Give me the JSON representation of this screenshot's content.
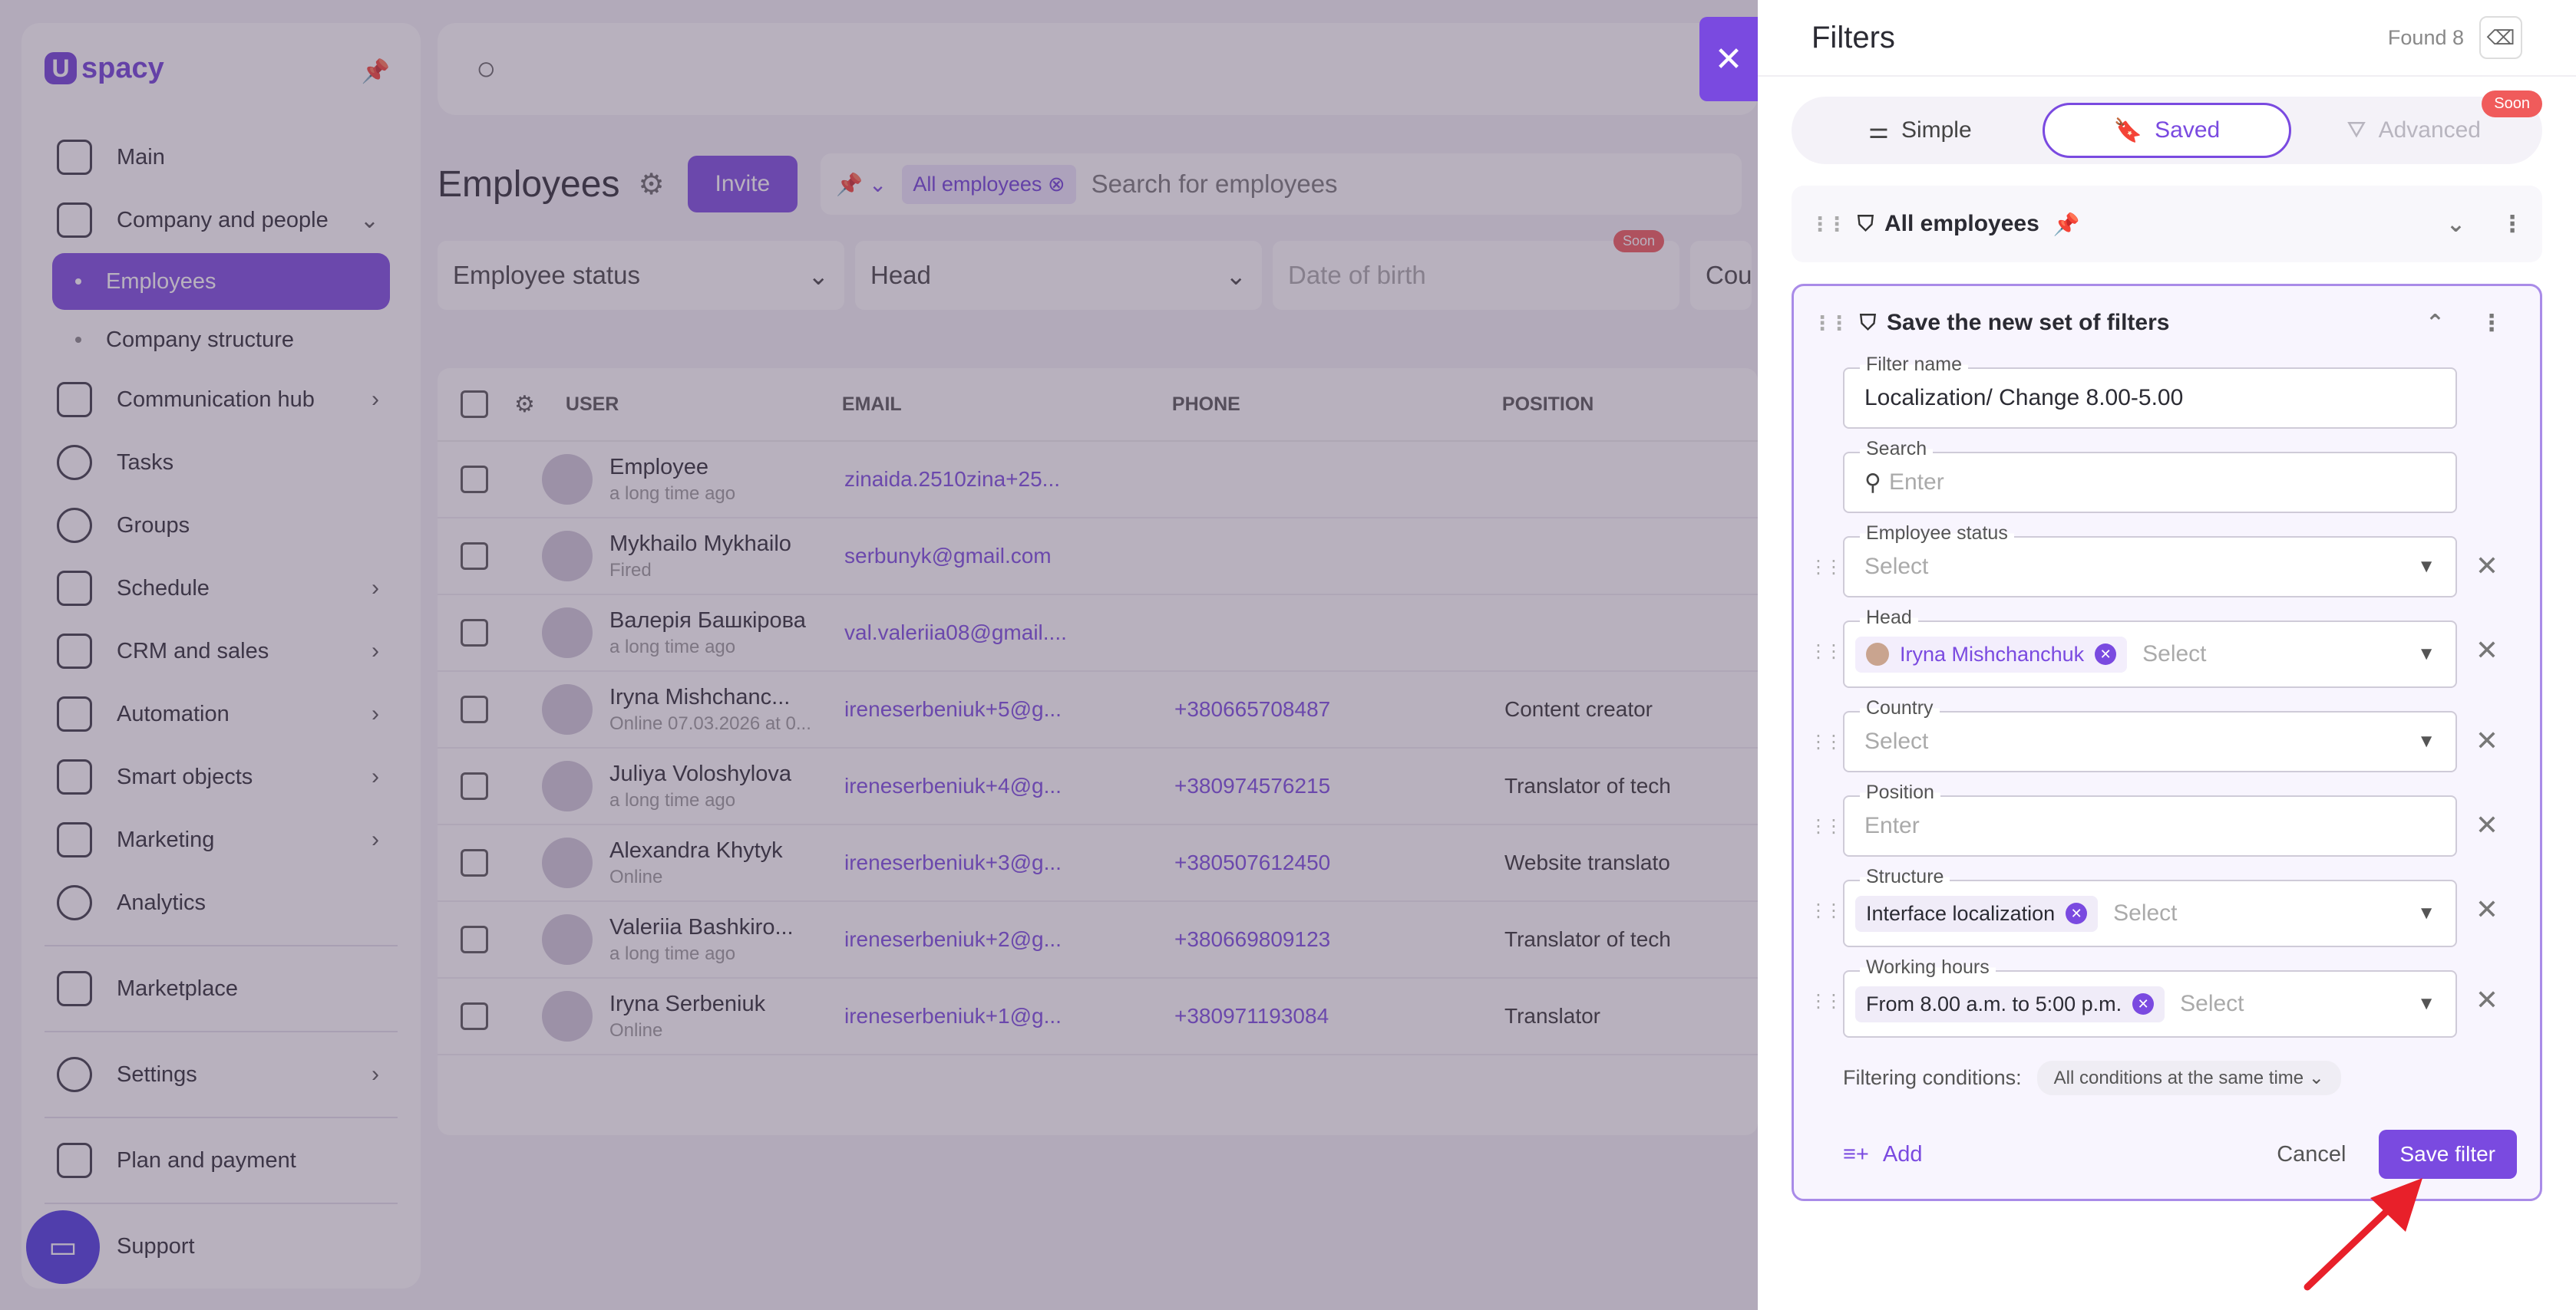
{
  "sidebar": {
    "logo_mark": "U",
    "logo_text": "spacy",
    "items": [
      {
        "label": "Main",
        "chev": ""
      },
      {
        "label": "Company and people",
        "chev": "⌄"
      },
      {
        "label": "Communication hub",
        "chev": "›"
      },
      {
        "label": "Tasks",
        "chev": ""
      },
      {
        "label": "Groups",
        "chev": ""
      },
      {
        "label": "Schedule",
        "chev": "›"
      },
      {
        "label": "CRM and sales",
        "chev": "›"
      },
      {
        "label": "Automation",
        "chev": "›"
      },
      {
        "label": "Smart objects",
        "chev": "›"
      },
      {
        "label": "Marketing",
        "chev": "›"
      },
      {
        "label": "Analytics",
        "chev": ""
      },
      {
        "label": "Marketplace",
        "chev": ""
      },
      {
        "label": "Settings",
        "chev": "›"
      },
      {
        "label": "Plan and payment",
        "chev": ""
      },
      {
        "label": "Support",
        "chev": ""
      }
    ],
    "sub_items": [
      "Employees",
      "Company structure"
    ]
  },
  "employees": {
    "title": "Employees",
    "invite_label": "Invite",
    "chip_all": "All employees",
    "search_placeholder": "Search for employees",
    "filters": [
      "Employee status",
      "Head",
      "Date of birth",
      "Cou"
    ],
    "soon": "Soon",
    "columns": [
      "USER",
      "EMAIL",
      "PHONE",
      "POSITION"
    ],
    "rows": [
      {
        "name": "Employee",
        "sub": "a long time ago",
        "email": "zinaida.2510zina+25...",
        "phone": "",
        "position": ""
      },
      {
        "name": "Mykhailo Mykhailo",
        "sub": "Fired",
        "email": "serbunyk@gmail.com",
        "phone": "",
        "position": ""
      },
      {
        "name": "Валерія Башкірова",
        "sub": "a long time ago",
        "email": "val.valeriia08@gmail....",
        "phone": "",
        "position": ""
      },
      {
        "name": "Iryna Mishchanc...",
        "sub": "Online 07.03.2026 at 0...",
        "email": "ireneserbeniuk+5@g...",
        "phone": "+380665708487",
        "position": "Content creator"
      },
      {
        "name": "Juliya Voloshylova",
        "sub": "a long time ago",
        "email": "ireneserbeniuk+4@g...",
        "phone": "+380974576215",
        "position": "Translator of tech"
      },
      {
        "name": "Alexandra Khytyk",
        "sub": "Online",
        "email": "ireneserbeniuk+3@g...",
        "phone": "+380507612450",
        "position": "Website translato"
      },
      {
        "name": "Valeriia Bashkiro...",
        "sub": "a long time ago",
        "email": "ireneserbeniuk+2@g...",
        "phone": "+380669809123",
        "position": "Translator of tech"
      },
      {
        "name": "Iryna Serbeniuk",
        "sub": "Online",
        "email": "ireneserbeniuk+1@g...",
        "phone": "+380971193084",
        "position": "Translator"
      }
    ]
  },
  "panel": {
    "title": "Filters",
    "found": "Found 8",
    "tabs": {
      "simple": "Simple",
      "saved": "Saved",
      "advanced": "Advanced",
      "soon": "Soon"
    },
    "saved_set": "All employees",
    "new_set_title": "Save the new set of filters",
    "fields": {
      "filter_name": {
        "label": "Filter name",
        "value": "Localization/ Change 8.00-5.00"
      },
      "search": {
        "label": "Search",
        "placeholder": "Enter"
      },
      "employee_status": {
        "label": "Employee status",
        "placeholder": "Select"
      },
      "head": {
        "label": "Head",
        "chip": "Iryna Mishchanchuk",
        "placeholder": "Select"
      },
      "country": {
        "label": "Country",
        "placeholder": "Select"
      },
      "position": {
        "label": "Position",
        "placeholder": "Enter"
      },
      "structure": {
        "label": "Structure",
        "chip": "Interface localization",
        "placeholder": "Select"
      },
      "working_hours": {
        "label": "Working hours",
        "chip": "From 8.00 a.m. to 5:00 p.m.",
        "placeholder": "Select"
      }
    },
    "conditions_label": "Filtering conditions:",
    "conditions_value": "All conditions at the same time",
    "add_label": "Add",
    "cancel_label": "Cancel",
    "save_label": "Save filter"
  },
  "colors": {
    "accent": "#7a4ae0",
    "arrow": "#e8202a",
    "soon": "#f05b5b"
  }
}
